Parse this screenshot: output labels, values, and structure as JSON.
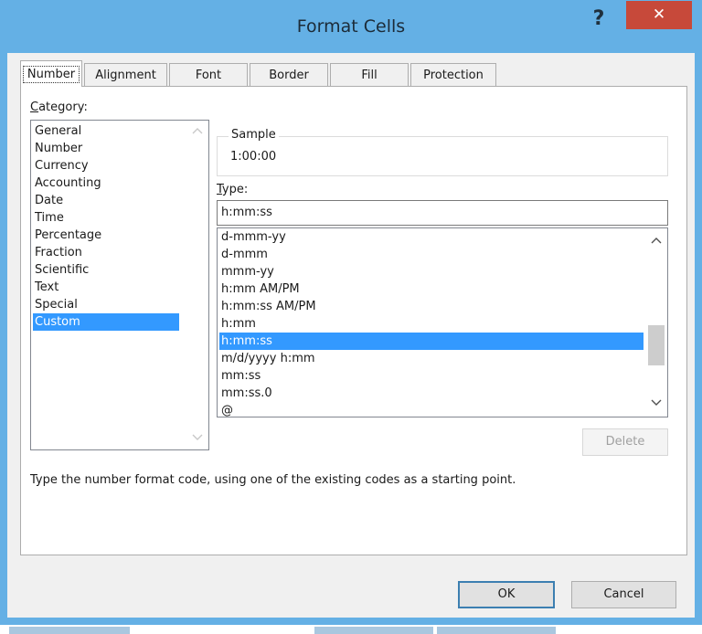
{
  "window": {
    "title": "Format Cells",
    "help_label": "?",
    "close_label": "✕"
  },
  "tabs": [
    {
      "label": "Number",
      "active": true
    },
    {
      "label": "Alignment",
      "active": false
    },
    {
      "label": "Font",
      "active": false
    },
    {
      "label": "Border",
      "active": false
    },
    {
      "label": "Fill",
      "active": false
    },
    {
      "label": "Protection",
      "active": false
    }
  ],
  "category": {
    "label_u": "C",
    "label_rest": "ategory:",
    "items": [
      "General",
      "Number",
      "Currency",
      "Accounting",
      "Date",
      "Time",
      "Percentage",
      "Fraction",
      "Scientific",
      "Text",
      "Special",
      "Custom"
    ],
    "selected": "Custom"
  },
  "sample": {
    "legend": "Sample",
    "value": "1:00:00"
  },
  "type": {
    "label_u": "T",
    "label_rest": "ype:",
    "value": "h:mm:ss",
    "options": [
      "d-mmm-yy",
      "d-mmm",
      "mmm-yy",
      "h:mm AM/PM",
      "h:mm:ss AM/PM",
      "h:mm",
      "h:mm:ss",
      "m/d/yyyy h:mm",
      "mm:ss",
      "mm:ss.0",
      "@"
    ],
    "selected": "h:mm:ss"
  },
  "buttons": {
    "delete": "Delete",
    "ok": "OK",
    "cancel": "Cancel"
  },
  "hint": "Type the number format code, using one of the existing codes as a starting point.",
  "colors": {
    "title_bar": "#64b0e5",
    "close_button": "#c7493a",
    "selection": "#3399ff"
  },
  "icons": {
    "up_arrow": "chevron-up-icon",
    "down_arrow": "chevron-down-icon"
  }
}
